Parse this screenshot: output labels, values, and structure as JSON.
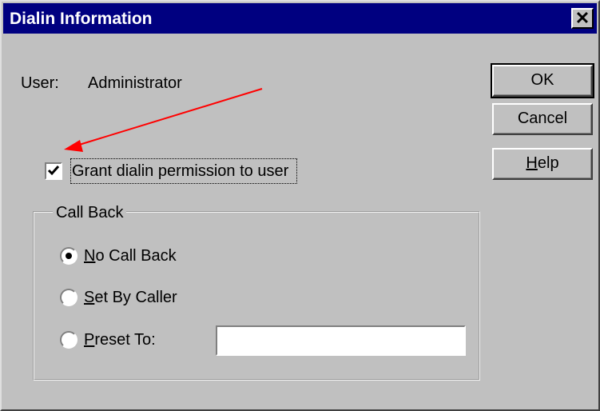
{
  "window": {
    "title": "Dialin Information",
    "close_glyph": "✕"
  },
  "user": {
    "label": "User:",
    "value": "Administrator"
  },
  "buttons": {
    "ok": "OK",
    "cancel": "Cancel",
    "help_accel": "H",
    "help_rest": "elp"
  },
  "permission": {
    "label": "Grant dialin permission to user",
    "checked": true
  },
  "callback": {
    "group_label": "Call Back",
    "options": [
      {
        "accel": "N",
        "rest": "o Call Back",
        "selected": true
      },
      {
        "accel": "S",
        "rest": "et By Caller",
        "selected": false
      },
      {
        "accel": "P",
        "rest": "reset To:",
        "selected": false
      }
    ],
    "preset_value": ""
  },
  "annotation": {
    "arrow_color": "#ff0000"
  },
  "colors": {
    "title_bar": "#000080",
    "face": "#c0c0c0"
  }
}
